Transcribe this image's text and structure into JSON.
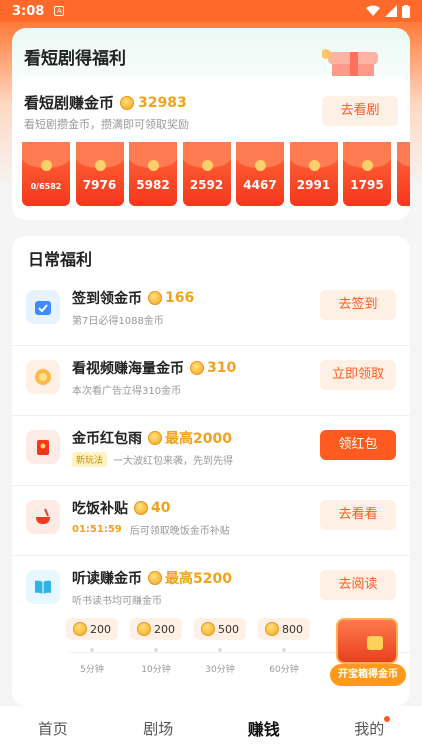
{
  "status": {
    "time": "3:08",
    "notif_glyph": "A"
  },
  "drama_card": {
    "title": "看短剧得福利",
    "earn_title": "看短剧赚金币",
    "earn_amount": "32983",
    "earn_sub": "看短剧攒金币，攒满即可领取奖励",
    "button": "去看剧",
    "envelopes": [
      "0/6582",
      "7976",
      "5982",
      "2592",
      "4467",
      "2991",
      "1795",
      ""
    ]
  },
  "daily": {
    "title": "日常福利",
    "tasks": [
      {
        "name": "签到领金币",
        "reward": "166",
        "desc": "第7日必得1088金币",
        "button": "去签到",
        "icon": "calendar-check-icon"
      },
      {
        "name": "看视频赚海量金币",
        "reward": "310",
        "desc": "本次看广告立得310金币",
        "button": "立即领取",
        "icon": "coin-video-icon"
      },
      {
        "name": "金币红包雨",
        "reward": "最高2000",
        "tag": "新玩法",
        "desc": "一大波红包来袭，先到先得",
        "button": "领红包",
        "icon": "red-packet-icon"
      },
      {
        "name": "吃饭补贴",
        "reward": "40",
        "countdown": "01:51:59",
        "desc": "后可领取晚饭金币补贴",
        "button": "去看看",
        "icon": "bowl-icon"
      },
      {
        "name": "听读赚金币",
        "reward": "最高5200",
        "desc": "听书读书均可赚金币",
        "button": "去阅读",
        "icon": "book-icon"
      }
    ],
    "progress": {
      "chips": [
        "200",
        "200",
        "500",
        "800"
      ],
      "labels": [
        "5分钟",
        "10分钟",
        "30分钟",
        "60分钟"
      ]
    },
    "treasure_label": "开宝箱得金币"
  },
  "tabbar": {
    "items": [
      "首页",
      "剧场",
      "赚钱",
      "我的"
    ],
    "active": "赚钱"
  },
  "colors": {
    "accent": "#ff5a1f",
    "coin": "#f3a21c",
    "header": "#ff6a2a"
  }
}
